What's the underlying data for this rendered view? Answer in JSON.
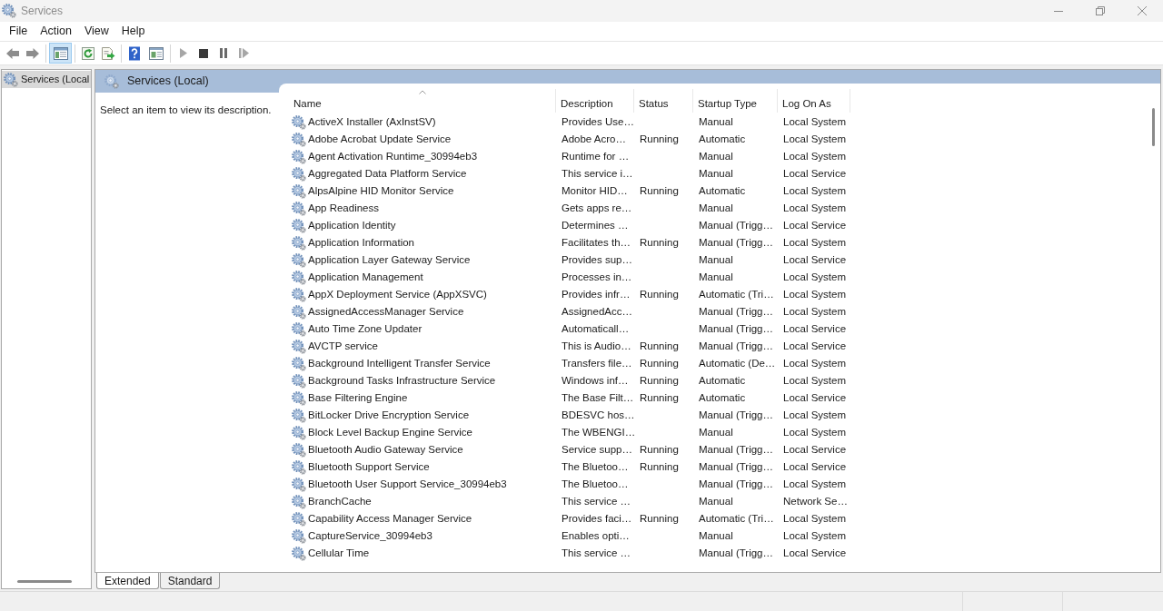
{
  "window": {
    "title": "Services"
  },
  "menu": [
    "File",
    "Action",
    "View",
    "Help"
  ],
  "toolbar": {
    "show_hide_tree": {
      "on": true
    }
  },
  "tree": [
    {
      "label": "Services (Local",
      "selected": true
    }
  ],
  "pane": {
    "title": "Services (Local)",
    "description": "Select an item to view its description."
  },
  "table": {
    "columns": [
      {
        "label": "Name",
        "sorted": true
      },
      {
        "label": "Description",
        "sorted": false
      },
      {
        "label": "Status",
        "sorted": false
      },
      {
        "label": "Startup Type",
        "sorted": false
      },
      {
        "label": "Log On As",
        "sorted": false
      }
    ],
    "rows": [
      {
        "name": "ActiveX Installer (AxInstSV)",
        "description": "Provides Use…",
        "startup_type": "Manual",
        "log_on_as": "Local System"
      },
      {
        "name": "Adobe Acrobat Update Service",
        "description": "Adobe Acro…",
        "status": "Running",
        "startup_type": "Automatic",
        "log_on_as": "Local System"
      },
      {
        "name": "Agent Activation Runtime_30994eb3",
        "description": "Runtime for …",
        "startup_type": "Manual",
        "log_on_as": "Local System"
      },
      {
        "name": "Aggregated Data Platform Service",
        "description": "This service i…",
        "startup_type": "Manual",
        "log_on_as": "Local Service"
      },
      {
        "name": "AlpsAlpine HID Monitor Service",
        "description": "Monitor HID…",
        "status": "Running",
        "startup_type": "Automatic",
        "log_on_as": "Local System"
      },
      {
        "name": "App Readiness",
        "description": "Gets apps re…",
        "startup_type": "Manual",
        "log_on_as": "Local System"
      },
      {
        "name": "Application Identity",
        "description": "Determines …",
        "startup_type": "Manual (Trigg…",
        "log_on_as": "Local Service"
      },
      {
        "name": "Application Information",
        "description": "Facilitates th…",
        "status": "Running",
        "startup_type": "Manual (Trigg…",
        "log_on_as": "Local System"
      },
      {
        "name": "Application Layer Gateway Service",
        "description": "Provides sup…",
        "startup_type": "Manual",
        "log_on_as": "Local Service"
      },
      {
        "name": "Application Management",
        "description": "Processes in…",
        "startup_type": "Manual",
        "log_on_as": "Local System"
      },
      {
        "name": "AppX Deployment Service (AppXSVC)",
        "description": "Provides infr…",
        "status": "Running",
        "startup_type": "Automatic (Tri…",
        "log_on_as": "Local System"
      },
      {
        "name": "AssignedAccessManager Service",
        "description": "AssignedAcc…",
        "startup_type": "Manual (Trigg…",
        "log_on_as": "Local System"
      },
      {
        "name": "Auto Time Zone Updater",
        "description": "Automaticall…",
        "startup_type": "Manual (Trigg…",
        "log_on_as": "Local Service"
      },
      {
        "name": "AVCTP service",
        "description": "This is Audio…",
        "status": "Running",
        "startup_type": "Manual (Trigg…",
        "log_on_as": "Local Service"
      },
      {
        "name": "Background Intelligent Transfer Service",
        "description": "Transfers file…",
        "status": "Running",
        "startup_type": "Automatic (De…",
        "log_on_as": "Local System"
      },
      {
        "name": "Background Tasks Infrastructure Service",
        "description": "Windows inf…",
        "status": "Running",
        "startup_type": "Automatic",
        "log_on_as": "Local System"
      },
      {
        "name": "Base Filtering Engine",
        "description": "The Base Filt…",
        "status": "Running",
        "startup_type": "Automatic",
        "log_on_as": "Local Service"
      },
      {
        "name": "BitLocker Drive Encryption Service",
        "description": "BDESVC hos…",
        "startup_type": "Manual (Trigg…",
        "log_on_as": "Local System"
      },
      {
        "name": "Block Level Backup Engine Service",
        "description": "The WBENGI…",
        "startup_type": "Manual",
        "log_on_as": "Local System"
      },
      {
        "name": "Bluetooth Audio Gateway Service",
        "description": "Service supp…",
        "status": "Running",
        "startup_type": "Manual (Trigg…",
        "log_on_as": "Local Service"
      },
      {
        "name": "Bluetooth Support Service",
        "description": "The Bluetoo…",
        "status": "Running",
        "startup_type": "Manual (Trigg…",
        "log_on_as": "Local Service"
      },
      {
        "name": "Bluetooth User Support Service_30994eb3",
        "description": "The Bluetoo…",
        "startup_type": "Manual (Trigg…",
        "log_on_as": "Local System"
      },
      {
        "name": "BranchCache",
        "description": "This service …",
        "startup_type": "Manual",
        "log_on_as": "Network Se…"
      },
      {
        "name": "Capability Access Manager Service",
        "description": "Provides faci…",
        "status": "Running",
        "startup_type": "Automatic (Tri…",
        "log_on_as": "Local System"
      },
      {
        "name": "CaptureService_30994eb3",
        "description": "Enables opti…",
        "startup_type": "Manual",
        "log_on_as": "Local System"
      },
      {
        "name": "Cellular Time",
        "description": "This service …",
        "startup_type": "Manual (Trigg…",
        "log_on_as": "Local Service"
      }
    ]
  },
  "view_tabs": [
    {
      "label": "Extended",
      "selected": true
    },
    {
      "label": "Standard",
      "selected": false
    }
  ]
}
